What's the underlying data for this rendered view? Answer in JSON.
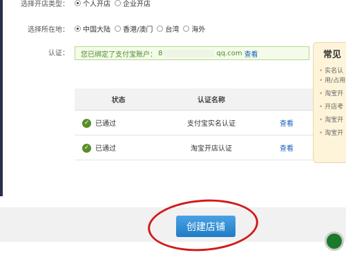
{
  "shop_type": {
    "label": "选择开店类型：",
    "options": [
      {
        "label": "个人开店",
        "checked": true
      },
      {
        "label": "企业开店",
        "checked": false
      }
    ]
  },
  "region": {
    "label": "选择所在地：",
    "options": [
      {
        "label": "中国大陆",
        "checked": true
      },
      {
        "label": "香港/澳门",
        "checked": false
      },
      {
        "label": "台湾",
        "checked": false
      },
      {
        "label": "海外",
        "checked": false
      }
    ]
  },
  "auth": {
    "label": "认证：",
    "message_prefix": "您已绑定了支付宝账户：",
    "account_start": "8",
    "account_end": "qq.com",
    "view_link": "查看"
  },
  "table": {
    "headers": [
      "状态",
      "认证名称",
      ""
    ],
    "rows": [
      {
        "status": "已通过",
        "name": "支付宝实名认证",
        "action": "查看"
      },
      {
        "status": "已通过",
        "name": "淘宝开店认证",
        "action": "查看"
      }
    ]
  },
  "side_panel": {
    "title": "常见",
    "items": [
      "实名认",
      "用/占用",
      "淘宝开",
      "开店考",
      "淘宝开",
      "淘宝开"
    ]
  },
  "footer": {
    "create_button": "创建店铺"
  },
  "colors": {
    "accent": "#1f7cc6",
    "success": "#5a8d2a",
    "annotation": "#d21a1a"
  }
}
